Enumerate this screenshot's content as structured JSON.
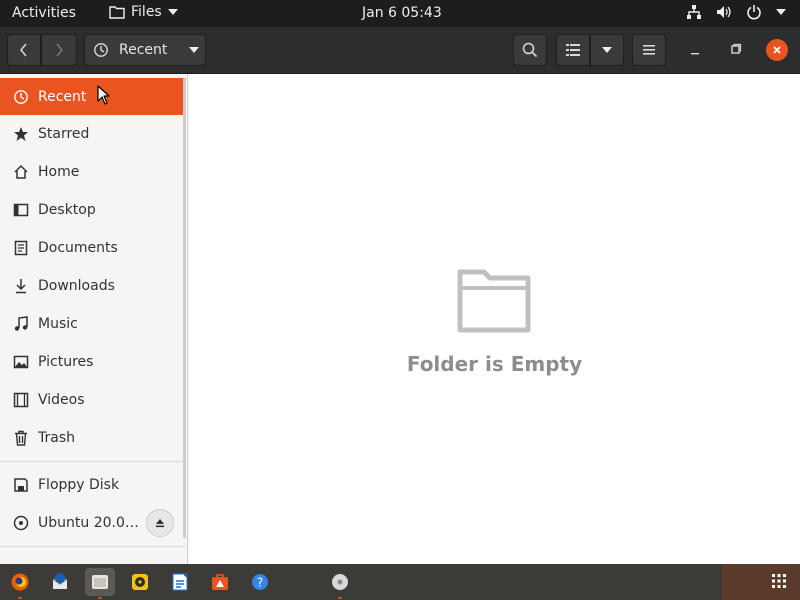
{
  "topbar": {
    "activities": "Activities",
    "app_name": "Files",
    "clock": "Jan 6  05:43"
  },
  "headerbar": {
    "location": "Recent"
  },
  "sidebar": {
    "items": [
      {
        "label": "Recent",
        "icon": "clock-icon",
        "active": true
      },
      {
        "label": "Starred",
        "icon": "star-icon"
      },
      {
        "label": "Home",
        "icon": "home-icon"
      },
      {
        "label": "Desktop",
        "icon": "desktop-icon"
      },
      {
        "label": "Documents",
        "icon": "document-icon"
      },
      {
        "label": "Downloads",
        "icon": "download-icon"
      },
      {
        "label": "Music",
        "icon": "music-icon"
      },
      {
        "label": "Pictures",
        "icon": "picture-icon"
      },
      {
        "label": "Videos",
        "icon": "video-icon"
      },
      {
        "label": "Trash",
        "icon": "trash-icon"
      }
    ],
    "devices": [
      {
        "label": "Floppy Disk",
        "icon": "floppy-icon"
      },
      {
        "label": "Ubuntu 20.0…",
        "icon": "disc-icon"
      }
    ]
  },
  "content": {
    "empty_label": "Folder is Empty"
  },
  "colors": {
    "accent": "#e95420",
    "topbar_bg": "#1d1d1d",
    "headerbar_bg": "#2d2d2d",
    "dock_bg": "#3c3b37"
  },
  "dock": {
    "items": [
      "firefox-icon",
      "thunderbird-icon",
      "files-icon",
      "rhythmbox-icon",
      "writer-icon",
      "software-icon",
      "help-icon",
      "disc-icon"
    ]
  }
}
